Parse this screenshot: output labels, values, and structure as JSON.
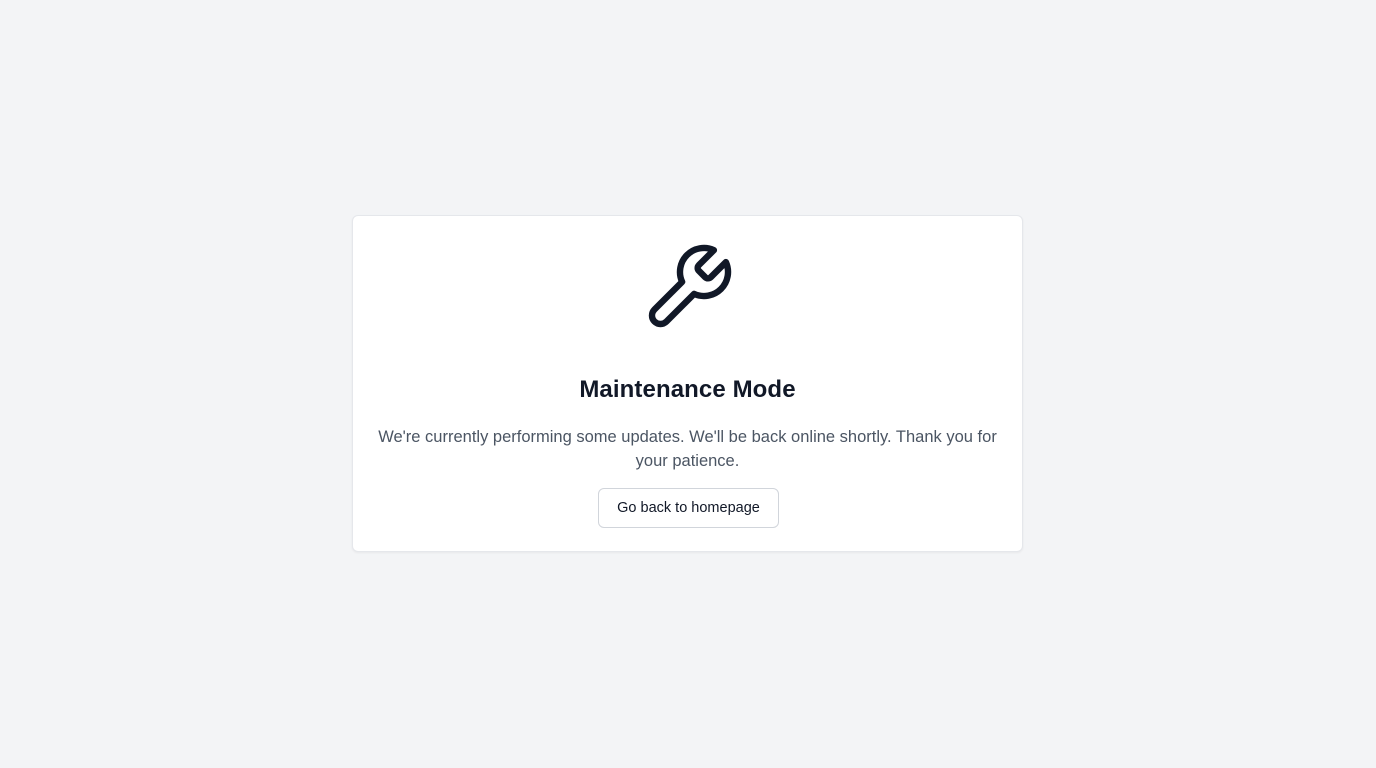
{
  "page": {
    "background_color": "#f3f4f6"
  },
  "card": {
    "icon": "wrench-icon",
    "title": "Maintenance Mode",
    "message": "We're currently performing some updates. We'll be back online shortly. Thank you for your patience.",
    "button_label": "Go back to homepage"
  },
  "colors": {
    "title": "#111827",
    "message": "#4b5563",
    "icon_stroke": "#111827"
  }
}
